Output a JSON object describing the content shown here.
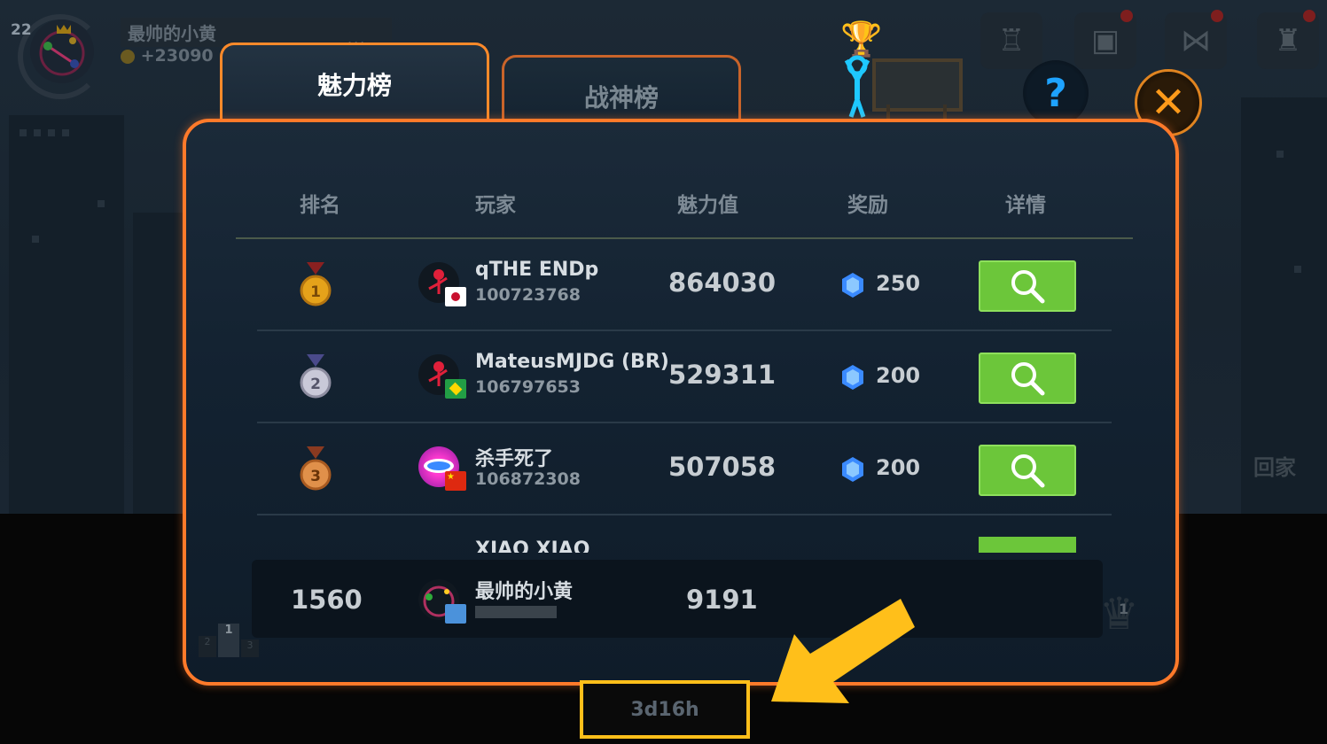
{
  "profile": {
    "level": "22",
    "name": "最帅的小黄",
    "coins": "+23090",
    "more": "..."
  },
  "top_icons": [
    "dance-icon",
    "gift-icon",
    "bow-icon",
    "hat-icon"
  ],
  "help_label": "?",
  "tabs": {
    "active": "魅力榜",
    "inactive": "战神榜"
  },
  "headers": {
    "rank": "排名",
    "player": "玩家",
    "charm": "魅力值",
    "reward": "奖励",
    "detail": "详情"
  },
  "rows": [
    {
      "rank": "1",
      "name": "qTHE ENDp",
      "id": "100723768",
      "score": "864030",
      "reward": "250",
      "flag": "JP"
    },
    {
      "rank": "2",
      "name": "MateusMJDG (BR)",
      "id": "106797653",
      "score": "529311",
      "reward": "200",
      "flag": "BR"
    },
    {
      "rank": "3",
      "name": "杀手死了",
      "id": "106872308",
      "score": "507058",
      "reward": "200",
      "flag": "CN"
    }
  ],
  "partial_row": {
    "name": "XIAO XIAO"
  },
  "my_row": {
    "rank": "1560",
    "name": "最帅的小黄",
    "score": "9191"
  },
  "timer": "3d16h",
  "side_label": "回家",
  "podium": {
    "first": "1",
    "second": "2",
    "third": "3"
  },
  "trophy_label": "1",
  "colors": {
    "accent": "#ff7a2a",
    "search_button": "#6cc63a",
    "highlight": "#ffbf1a"
  }
}
